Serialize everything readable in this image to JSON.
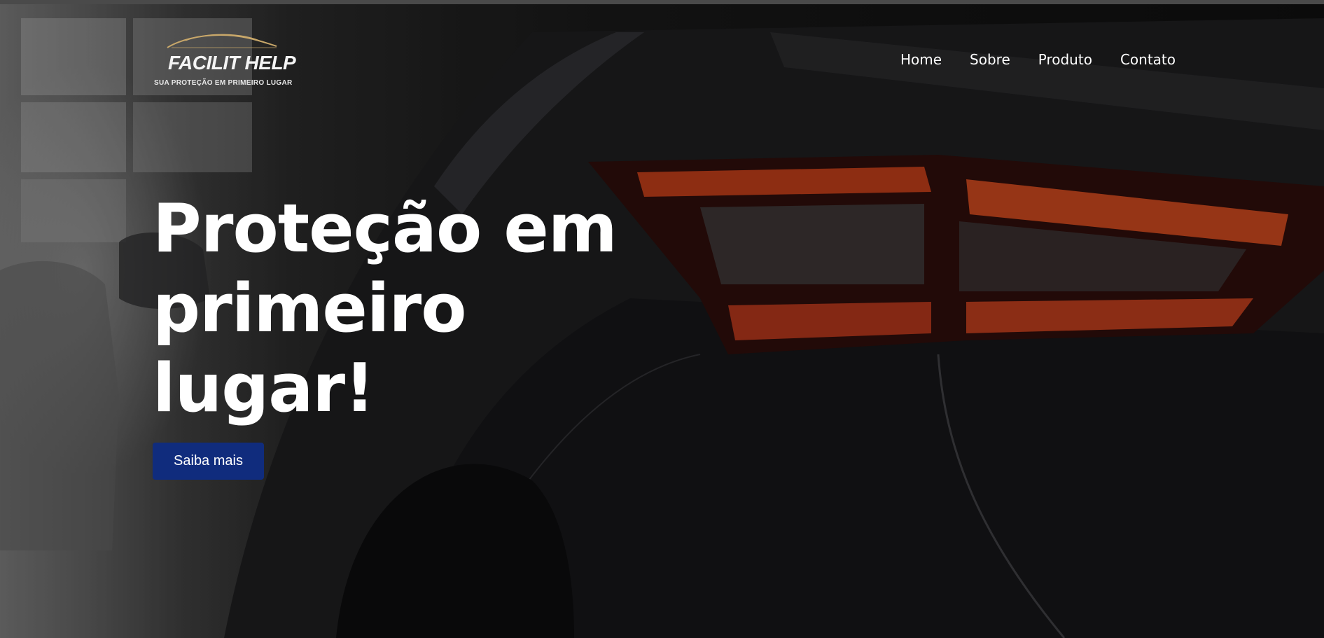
{
  "brand": {
    "name": "FACILIT HELP",
    "tagline": "SUA PROTEÇÃO EM PRIMEIRO LUGAR",
    "logo_icon": "car-silhouette-icon",
    "logo_accent_color": "#c9a86a"
  },
  "nav": {
    "items": [
      {
        "label": "Home"
      },
      {
        "label": "Sobre"
      },
      {
        "label": "Produto"
      },
      {
        "label": "Contato"
      }
    ]
  },
  "hero": {
    "title_lines": [
      "Proteção em",
      "primeiro",
      "lugar!"
    ],
    "cta_label": "Saiba mais",
    "cta_color": "#102c7d",
    "background_image": "dark-car-taillight-photo"
  }
}
